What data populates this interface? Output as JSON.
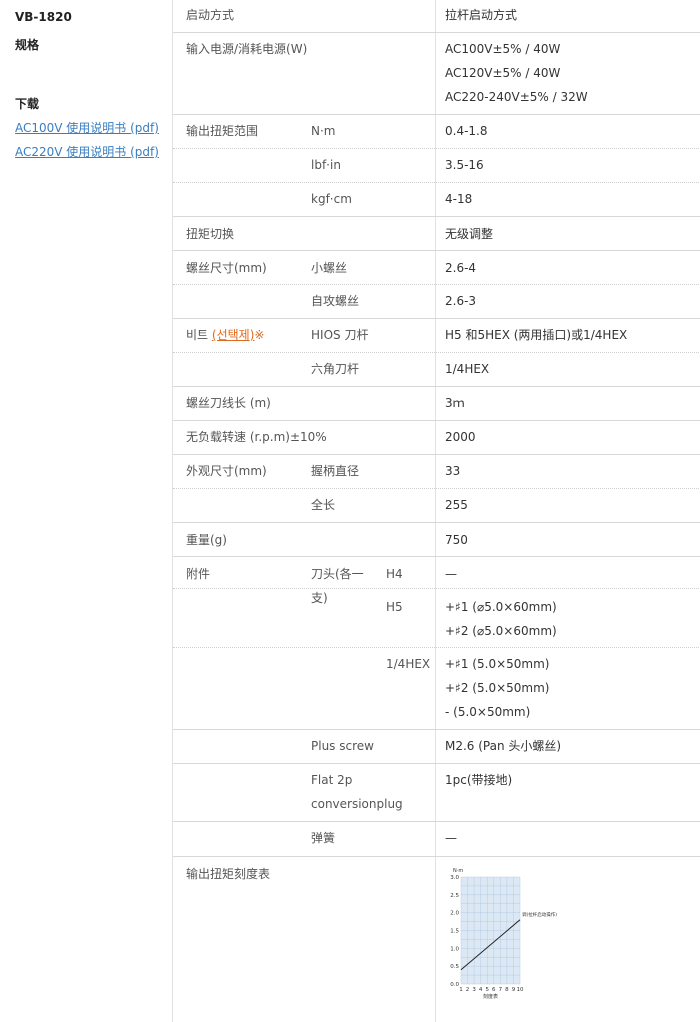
{
  "sidebar": {
    "model": "VB-1820",
    "spec_heading": "规格",
    "download_heading": "下载",
    "links": [
      "AC100V 使用说明书 (pdf)",
      "AC220V 使用说明书 (pdf)"
    ]
  },
  "spec": {
    "start_method": {
      "label": "启动方式",
      "value": "拉杆启动方式"
    },
    "power": {
      "label": "输入电源/消耗电源(W)",
      "values": [
        "AC100V±5% / 40W",
        "AC120V±5% / 40W",
        "AC220-240V±5% / 32W"
      ]
    },
    "torque_range": {
      "label": "输出扭矩范围",
      "rows": [
        {
          "unit": "N·m",
          "value": "0.4-1.8"
        },
        {
          "unit": "lbf·in",
          "value": "3.5-16"
        },
        {
          "unit": "kgf·cm",
          "value": "4-18"
        }
      ]
    },
    "torque_switch": {
      "label": "扭矩切换",
      "value": "无级调整"
    },
    "screw_size": {
      "label": "螺丝尺寸(mm)",
      "rows": [
        {
          "type": "小螺丝",
          "value": "2.6-4"
        },
        {
          "type": "自攻螺丝",
          "value": "2.6-3"
        }
      ]
    },
    "bit": {
      "label_prefix": "비트 ",
      "label_link": "(선택제)",
      "label_suffix": "※",
      "rows": [
        {
          "type": "HIOS 刀杆",
          "value": "H5 和5HEX (两用插口)或1/4HEX"
        },
        {
          "type": "六角刀杆",
          "value": "1/4HEX"
        }
      ]
    },
    "cord_length": {
      "label": "螺丝刀线长 (m)",
      "value": "3ｍ"
    },
    "no_load_speed": {
      "label": "无负载转速 (r.p.m)±10%",
      "value": "2000"
    },
    "dimensions": {
      "label": "外观尺寸(mm)",
      "rows": [
        {
          "type": "握柄直径",
          "value": "33"
        },
        {
          "type": "全长",
          "value": "255"
        }
      ]
    },
    "weight": {
      "label": "重量(g)",
      "value": "750"
    },
    "accessories": {
      "label": "附件",
      "bit_label_1": "刀头(各一",
      "bit_label_2": "支)",
      "bits": [
        {
          "size": "H4",
          "values": [
            "—"
          ]
        },
        {
          "size": "H5",
          "values": [
            "+♯1 (⌀5.0×60mm)",
            "+♯2 (⌀5.0×60mm)"
          ]
        },
        {
          "size": "1/4HEX",
          "values": [
            "+♯1 (5.0×50mm)",
            "+♯2 (5.0×50mm)",
            "- (5.0×50mm)"
          ]
        }
      ],
      "plus_screw": {
        "label": "Plus screw",
        "value": "M2.6 (Pan 头小螺丝)"
      },
      "flat_plug": {
        "label_1": "Flat 2p",
        "label_2": "conversionplug",
        "value": "1pc(带接地)"
      },
      "spring": {
        "label": "弹簧",
        "value": "—"
      }
    },
    "scale_chart": {
      "label": "输出扭矩刻度表"
    }
  },
  "chart_data": {
    "type": "line",
    "title": "",
    "ylabel": "N·m",
    "xlabel": "刻度表",
    "y_ticks": [
      "3.0",
      "2.5",
      "2.0",
      "1.5",
      "1.0",
      "0.5",
      "0.0"
    ],
    "x_ticks": [
      "1",
      "2",
      "3",
      "4",
      "5",
      "6",
      "7",
      "8",
      "9",
      "10"
    ],
    "ylim": [
      0,
      3.0
    ],
    "xlim": [
      1,
      10
    ],
    "series": [
      {
        "name": "调(拉杆启动操作)",
        "x": [
          1,
          10
        ],
        "y": [
          0.4,
          1.8
        ]
      }
    ],
    "grid": true,
    "colors": {
      "line": "#222222",
      "grid_bg": "#dce9f5",
      "grid_line": "#a9c4de"
    }
  }
}
